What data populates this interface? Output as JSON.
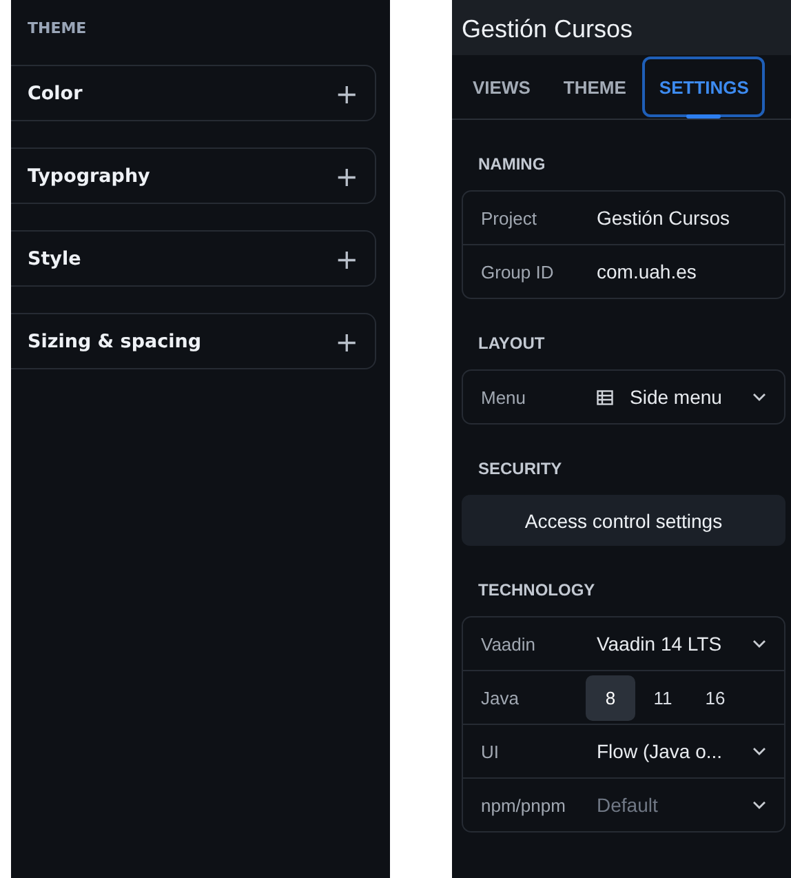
{
  "theme_panel": {
    "heading": "THEME",
    "sections": [
      {
        "label": "Color",
        "icon": "+",
        "expanded": false
      },
      {
        "label": "Typography",
        "icon": "+",
        "expanded": false
      },
      {
        "label": "Style",
        "icon": "+",
        "expanded": false
      },
      {
        "label": "Sizing & spacing",
        "icon": "+",
        "expanded": false
      }
    ]
  },
  "settings_panel": {
    "title": "Gestión Cursos",
    "tabs": [
      {
        "label": "VIEWS",
        "selected": false
      },
      {
        "label": "THEME",
        "selected": false
      },
      {
        "label": "SETTINGS",
        "selected": true
      }
    ],
    "naming": {
      "heading": "NAMING",
      "rows": [
        {
          "kind": "text",
          "label": "Project",
          "value": "Gestión Cursos"
        },
        {
          "kind": "text",
          "label": "Group ID",
          "value": "com.uah.es"
        }
      ]
    },
    "layout": {
      "heading": "LAYOUT",
      "rows": [
        {
          "kind": "select",
          "label": "Menu",
          "value": "Side menu",
          "icon": true
        }
      ]
    },
    "security": {
      "heading": "SECURITY",
      "button": "Access control settings"
    },
    "technology": {
      "heading": "TECHNOLOGY",
      "rows": [
        {
          "kind": "select",
          "label": "Vaadin",
          "value": "Vaadin 14 LTS"
        },
        {
          "kind": "segmented",
          "label": "Java",
          "options": [
            {
              "label": "8",
              "selected": true
            },
            {
              "label": "11",
              "selected": false
            },
            {
              "label": "16",
              "selected": false
            }
          ]
        },
        {
          "kind": "select",
          "label": "UI",
          "value": "Flow (Java o..."
        },
        {
          "kind": "select",
          "label": "npm/pnpm",
          "placeholder": "Default"
        }
      ]
    }
  }
}
